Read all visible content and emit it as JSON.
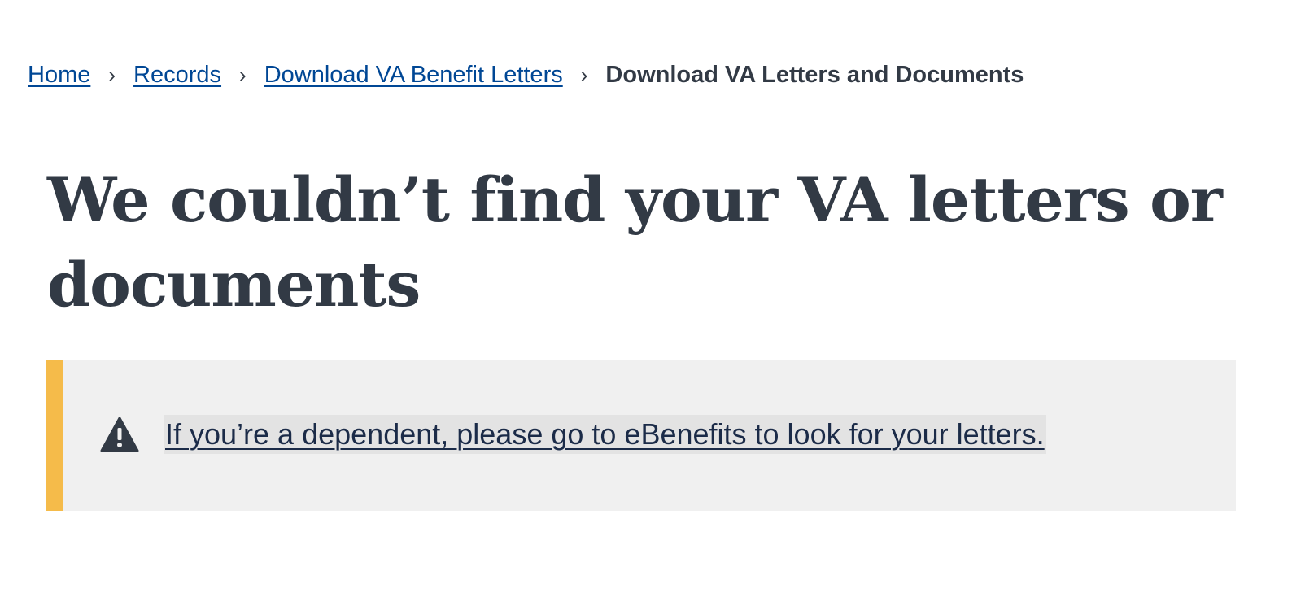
{
  "breadcrumb": {
    "items": [
      {
        "label": "Home"
      },
      {
        "label": "Records"
      },
      {
        "label": "Download VA Benefit Letters"
      }
    ],
    "separator": "›",
    "current": "Download VA Letters and Documents"
  },
  "page": {
    "title": "We couldn’t find your VA letters or documents"
  },
  "alert": {
    "type": "warning",
    "icon": "warning-triangle-icon",
    "link_text": "If you’re a dependent, please go to eBenefits to look for your letters.",
    "accent_color": "#f5bb4a",
    "background_color": "#f0f0f0"
  },
  "colors": {
    "link": "#004795",
    "text": "#323a45"
  }
}
